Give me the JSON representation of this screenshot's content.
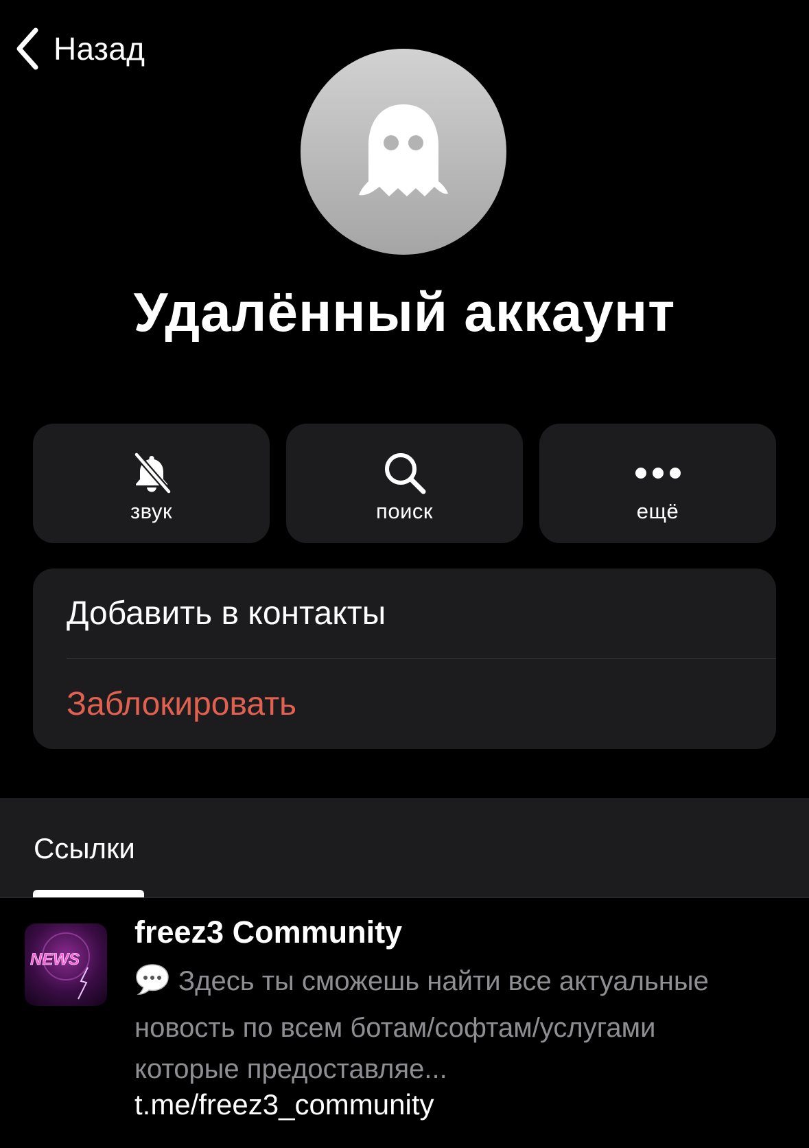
{
  "nav": {
    "back_label": "Назад",
    "back_icon": "chevron-left-icon"
  },
  "profile": {
    "avatar_icon": "ghost-icon",
    "name": "Удалённый аккаунт"
  },
  "actions": [
    {
      "label": "звук",
      "icon": "bell-slash-icon"
    },
    {
      "label": "поиск",
      "icon": "search-icon"
    },
    {
      "label": "ещё",
      "icon": "more-dots-icon"
    }
  ],
  "menu": {
    "add_contact": "Добавить в контакты",
    "block": "Заблокировать"
  },
  "links_section": {
    "tab_label": "Ссылки"
  },
  "link": {
    "thumb_text": "NEWS",
    "title": "freez3 Community",
    "description": "Здесь ты сможешь найти все актуальные новость по всем ботам/софтам/услугами которые предоставляе...",
    "url": "t.me/freez3_community"
  },
  "colors": {
    "background": "#000000",
    "card": "#1c1c1e",
    "destructive": "#e0614f",
    "secondary_text": "#8e8e93"
  }
}
